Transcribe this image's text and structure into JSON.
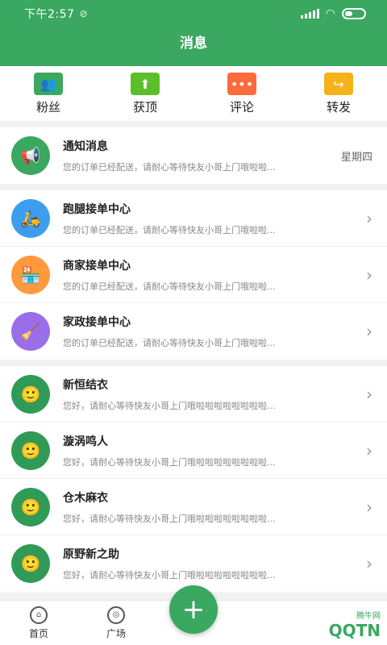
{
  "status_bar": {
    "time": "下午2:57",
    "mute_icon": "mute-icon"
  },
  "header": {
    "title": "消息"
  },
  "actions": [
    {
      "label": "粉丝",
      "icon": "fans-icon",
      "color": "#3aa860"
    },
    {
      "label": "获顶",
      "icon": "upvote-icon",
      "color": "#5cbf2a"
    },
    {
      "label": "评论",
      "icon": "comment-icon",
      "color": "#ff6a3d"
    },
    {
      "label": "转发",
      "icon": "forward-icon",
      "color": "#f6b21b"
    }
  ],
  "system": {
    "title": "通知消息",
    "preview": "您的订单已经配送，请耐心等待快友小哥上门哦啦啦...",
    "time": "星期四",
    "color": "#3aa860"
  },
  "centers": [
    {
      "title": "跑腿接单中心",
      "preview": "您的订单已经配送，请耐心等待快友小哥上门哦啦啦...",
      "color": "#3d9ef0"
    },
    {
      "title": "商家接单中心",
      "preview": "您的订单已经配送，请耐心等待快友小哥上门哦啦啦...",
      "color": "#ff9a3c"
    },
    {
      "title": "家政接单中心",
      "preview": "您的订单已经配送，请耐心等待快友小哥上门哦啦啦...",
      "color": "#9a6ee8"
    }
  ],
  "chats": [
    {
      "title": "新恒结衣",
      "preview": "您好，请耐心等待快友小哥上门哦啦啦啦啦啦啦啦啦..."
    },
    {
      "title": "漩涡鸣人",
      "preview": "您好，请耐心等待快友小哥上门哦啦啦啦啦啦啦啦啦..."
    },
    {
      "title": "仓木麻衣",
      "preview": "您好，请耐心等待快友小哥上门哦啦啦啦啦啦啦啦啦..."
    },
    {
      "title": "原野新之助",
      "preview": "您好，请耐心等待快友小哥上门哦啦啦啦啦啦啦啦啦..."
    }
  ],
  "tabs": [
    {
      "label": "首页",
      "icon": "home-icon"
    },
    {
      "label": "广场",
      "icon": "plaza-icon"
    }
  ],
  "fab": {
    "label": "+"
  },
  "watermark": {
    "text": "QQTN",
    "small": "腾牛网"
  }
}
